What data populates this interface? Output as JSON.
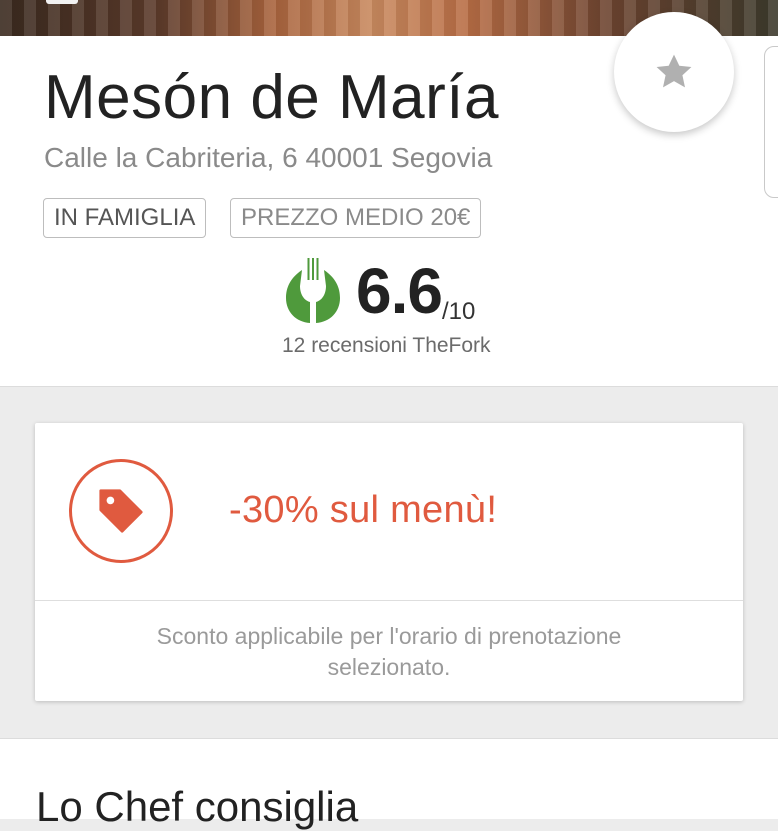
{
  "restaurant": {
    "name": "Mesón de María",
    "address": "Calle la Cabriteria, 6 40001 Segovia",
    "tags": [
      "IN FAMIGLIA",
      "PREZZO MEDIO 20€"
    ],
    "rating": {
      "score": "6.6",
      "out_of": "/10",
      "reviews": "12 recensioni TheFork"
    }
  },
  "promo": {
    "title": "-30% sul menù!",
    "note_line1": "Sconto applicabile per l'orario di prenotazione",
    "note_line2": "selezionato."
  },
  "next_section": {
    "title": "Lo Chef consiglia"
  },
  "colors": {
    "accent": "#e05a3f",
    "rating_green": "#4f9a3c",
    "favorite_star": "#b0b0b0"
  },
  "icons": [
    "favorite-star-icon",
    "thefork-rating-icon",
    "price-tag-icon"
  ]
}
